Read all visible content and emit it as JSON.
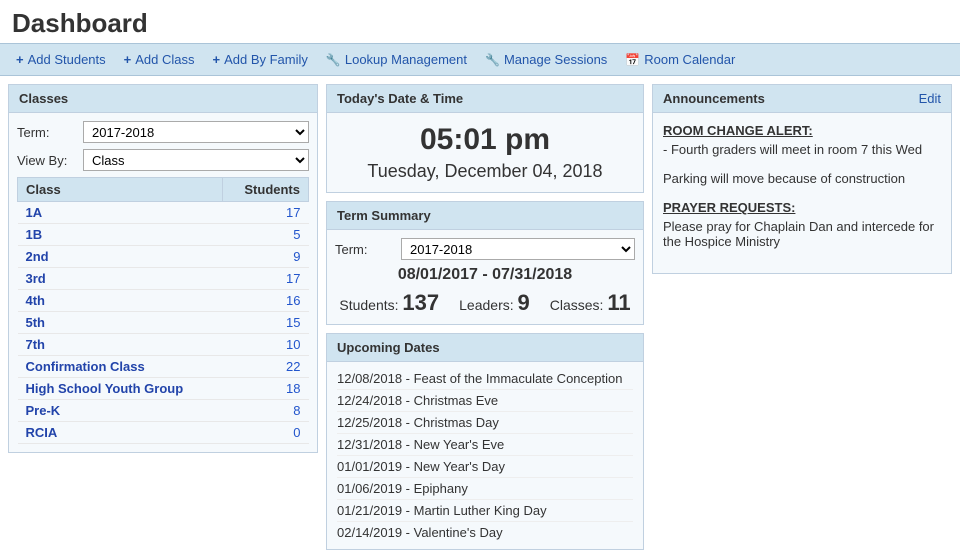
{
  "header": {
    "title": "Dashboard"
  },
  "toolbar": {
    "buttons": [
      {
        "id": "add-students",
        "label": "Add Students",
        "icon": "+"
      },
      {
        "id": "add-class",
        "label": "Add Class",
        "icon": "+"
      },
      {
        "id": "add-by-family",
        "label": "Add By Family",
        "icon": "+"
      },
      {
        "id": "lookup-management",
        "label": "Lookup Management",
        "icon": "🔧"
      },
      {
        "id": "manage-sessions",
        "label": "Manage Sessions",
        "icon": "🔧"
      },
      {
        "id": "room-calendar",
        "label": "Room Calendar",
        "icon": "📅"
      }
    ]
  },
  "classes_panel": {
    "title": "Classes",
    "term_label": "Term:",
    "term_value": "2017-2018",
    "viewby_label": "View By:",
    "viewby_value": "Class",
    "table": {
      "col_class": "Class",
      "col_students": "Students",
      "rows": [
        {
          "class": "1A",
          "students": "17"
        },
        {
          "class": "1B",
          "students": "5"
        },
        {
          "class": "2nd",
          "students": "9"
        },
        {
          "class": "3rd",
          "students": "17"
        },
        {
          "class": "4th",
          "students": "16"
        },
        {
          "class": "5th",
          "students": "15"
        },
        {
          "class": "7th",
          "students": "10"
        },
        {
          "class": "Confirmation Class",
          "students": "22"
        },
        {
          "class": "High School Youth Group",
          "students": "18"
        },
        {
          "class": "Pre-K",
          "students": "8"
        },
        {
          "class": "RCIA",
          "students": "0"
        }
      ]
    }
  },
  "datetime_panel": {
    "title": "Today's Date & Time",
    "time": "05:01 pm",
    "date": "Tuesday, December 04, 2018"
  },
  "term_summary": {
    "title": "Term Summary",
    "term_label": "Term:",
    "term_value": "2017-2018",
    "date_range": "08/01/2017 - 07/31/2018",
    "students_label": "Students:",
    "students_value": "137",
    "leaders_label": "Leaders:",
    "leaders_value": "9",
    "classes_label": "Classes:",
    "classes_value": "11"
  },
  "upcoming_dates": {
    "title": "Upcoming Dates",
    "items": [
      "12/08/2018 - Feast of the Immaculate Conception",
      "12/24/2018 - Christmas Eve",
      "12/25/2018 - Christmas Day",
      "12/31/2018 - New Year's Eve",
      "01/01/2019 - New Year's Day",
      "01/06/2019 - Epiphany",
      "01/21/2019 - Martin Luther King Day",
      "02/14/2019 - Valentine's Day"
    ]
  },
  "announcements": {
    "title": "Announcements",
    "edit_label": "Edit",
    "blocks": [
      {
        "title": "ROOM CHANGE ALERT:",
        "text": "- Fourth graders will meet in room 7 this Wed"
      },
      {
        "title": "",
        "text": "Parking will move because of construction"
      },
      {
        "title": "PRAYER REQUESTS:",
        "text": "Please pray for Chaplain Dan and intercede for the Hospice Ministry"
      }
    ]
  }
}
